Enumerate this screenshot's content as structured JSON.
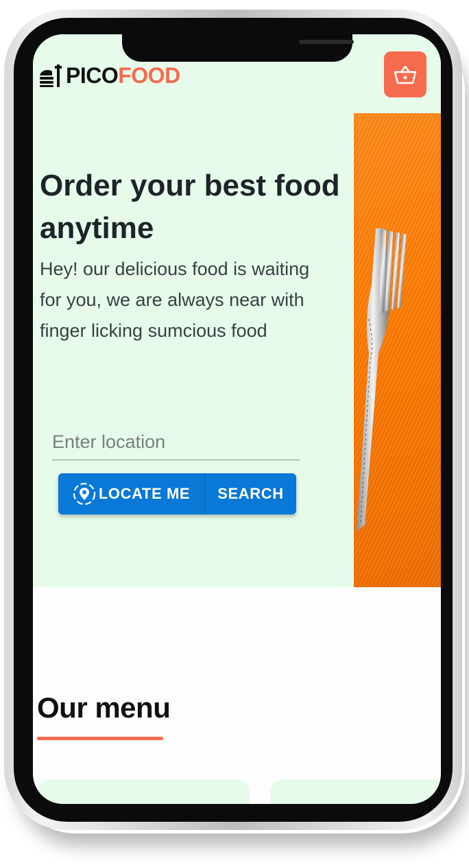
{
  "header": {
    "logo_part1": "PICO",
    "logo_part2": "FOOD",
    "logo_icon": "burger-stack-icon",
    "cart_icon": "basket-icon"
  },
  "hero": {
    "headline": "Order your best food anytime",
    "description": "Hey! our delicious food is waiting for you, we are always near with finger licking sumcious food",
    "image": "fork-on-orange-background",
    "location_placeholder": "Enter location",
    "location_value": "",
    "locate_button_label": "LOCATE ME",
    "locate_icon": "location-pin-icon",
    "search_button_label": "SEARCH"
  },
  "menu": {
    "title": "Our menu"
  },
  "colors": {
    "accent": "#f76b4f",
    "primary_button": "#0a78d6",
    "hero_background": "#e6fbea",
    "image_orange": "#ff7a00"
  }
}
